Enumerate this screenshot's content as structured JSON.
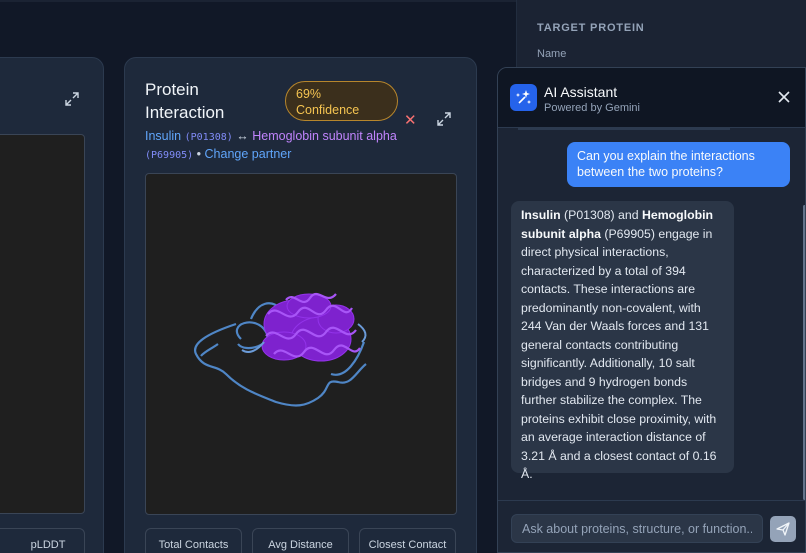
{
  "left_card": {
    "metric_label": "pLDDT"
  },
  "interaction_card": {
    "title": "Protein Interaction",
    "confidence_badge": "69% Confidence",
    "protein_a": {
      "name": "Insulin",
      "id": "(P01308)"
    },
    "arrow": "↔",
    "protein_b": {
      "name": "Hemoglobin subunit alpha",
      "id": "(P69905)"
    },
    "separator": "•",
    "change_partner": "Change partner",
    "metrics": [
      "Total Contacts",
      "Avg Distance",
      "Closest Contact"
    ],
    "colors": {
      "protein_a": "#60a5fa",
      "protein_b": "#9333ea"
    }
  },
  "right_panel": {
    "section_label": "TARGET PROTEIN",
    "name_label": "Name"
  },
  "assistant": {
    "title": "AI Assistant",
    "subtitle": "Powered by Gemini",
    "user_message": "Can you explain the interactions between the two proteins?",
    "ai_message": {
      "protein_a_name": "Insulin",
      "protein_a_id": " (P01308) and ",
      "protein_b_name": "Hemoglobin subunit alpha",
      "body": " (P69905) engage in direct physical interactions, characterized by a total of 394 contacts. These interactions are predominantly non-covalent, with 244 Van der Waals forces and 131 general contacts contributing significantly. Additionally, 10 salt bridges and 9 hydrogen bonds further stabilize the complex. The proteins exhibit close proximity, with an average interaction distance of 3.21 Å and a closest contact of 0.16 Å."
    },
    "input_placeholder": "Ask about proteins, structure, or function..",
    "icons": {
      "assistant": "sparkle-icon",
      "close": "close-icon",
      "send": "send-icon"
    }
  }
}
